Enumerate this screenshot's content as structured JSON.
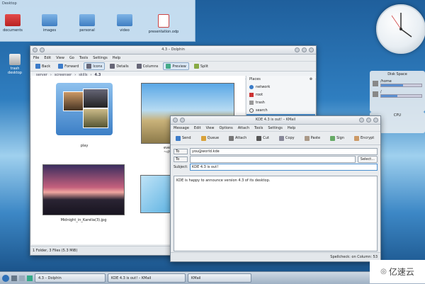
{
  "colors": {
    "accent": "#4a8fd0",
    "selection": "#4a8fd0",
    "desktop": "#2f7ec0"
  },
  "folderview": {
    "title": "Desktop",
    "items": [
      {
        "label": "documents",
        "icon": "folder-red-icon"
      },
      {
        "label": "images",
        "icon": "folder-images-icon"
      },
      {
        "label": "personal",
        "icon": "folder-icon"
      },
      {
        "label": "video",
        "icon": "folder-video-icon"
      },
      {
        "label": "presentation.odp",
        "icon": "presentation-file-icon"
      }
    ]
  },
  "desktop_icons": [
    {
      "label": "trash desktop",
      "icon": "trash-icon"
    }
  ],
  "dolphin": {
    "title": "4.3 – Dolphin",
    "menu": [
      "File",
      "Edit",
      "View",
      "Go",
      "Tools",
      "Settings",
      "Help"
    ],
    "toolbar": [
      {
        "label": "Back",
        "icon": "back-arrow-icon"
      },
      {
        "label": "Forward",
        "icon": "forward-arrow-icon"
      },
      {
        "label": "Icons",
        "icon": "icons-view-icon",
        "active": true
      },
      {
        "label": "Details",
        "icon": "details-view-icon"
      },
      {
        "label": "Columns",
        "icon": "columns-view-icon"
      },
      {
        "label": "Preview",
        "icon": "preview-icon",
        "active": true
      },
      {
        "label": "Split",
        "icon": "split-icon"
      }
    ],
    "breadcrumb": [
      "server",
      "screenser",
      "skills",
      "4.3"
    ],
    "files": [
      {
        "label": "play",
        "kind": "folder"
      },
      {
        "label": "eve",
        "label2": "~chrisn"
      },
      {
        "label": "Midnight_in_Karelia(3).jpg"
      },
      {
        "label": ""
      }
    ],
    "places_title": "Places",
    "places": [
      {
        "label": "network",
        "icon": "network-icon"
      },
      {
        "label": "root",
        "icon": "root-folder-icon"
      },
      {
        "label": "trash",
        "icon": "trash-icon"
      },
      {
        "label": "search",
        "icon": "search-icon"
      },
      {
        "label": "",
        "selected": true
      }
    ],
    "status": "1 Folder, 3 Files (5.3 MiB)"
  },
  "kmail": {
    "title": "KDE 4.3 is out! – KMail",
    "menu": [
      "Message",
      "Edit",
      "View",
      "Options",
      "Attach",
      "Tools",
      "Settings",
      "Help"
    ],
    "toolbar": [
      {
        "label": "Send",
        "icon": "send-icon"
      },
      {
        "label": "Queue",
        "icon": "queue-icon"
      },
      {
        "label": "Attach",
        "icon": "attach-icon"
      },
      {
        "label": "Cut",
        "icon": "cut-icon"
      },
      {
        "label": "Copy",
        "icon": "copy-icon"
      },
      {
        "label": "Paste",
        "icon": "paste-icon"
      },
      {
        "label": "Sign",
        "icon": "sign-icon"
      },
      {
        "label": "Encrypt",
        "icon": "encrypt-icon"
      }
    ],
    "to_label": "To",
    "to_value": "you@world.kde",
    "to2_label": "To",
    "to2_value": "",
    "select_button": "Select...",
    "subject_label": "Subject:",
    "subject_value": "KDE 4.3 is out!",
    "body": "KDE is happy to announce version 4.3 of its desktop.",
    "status": "Spellcheck: on   Column: 53"
  },
  "widgets": {
    "disk_title": "Disk Space",
    "disk_rows": [
      {
        "label": "/home",
        "fill": 0.55
      },
      {
        "label": "/",
        "fill": 0.4
      }
    ],
    "cpu_title": "CPU"
  },
  "taskbar": {
    "tasks": [
      "4.3 – Dolphin",
      "KDE 4.3 is out! – KMail",
      "KMail"
    ]
  },
  "watermark": {
    "text": "亿速云"
  }
}
